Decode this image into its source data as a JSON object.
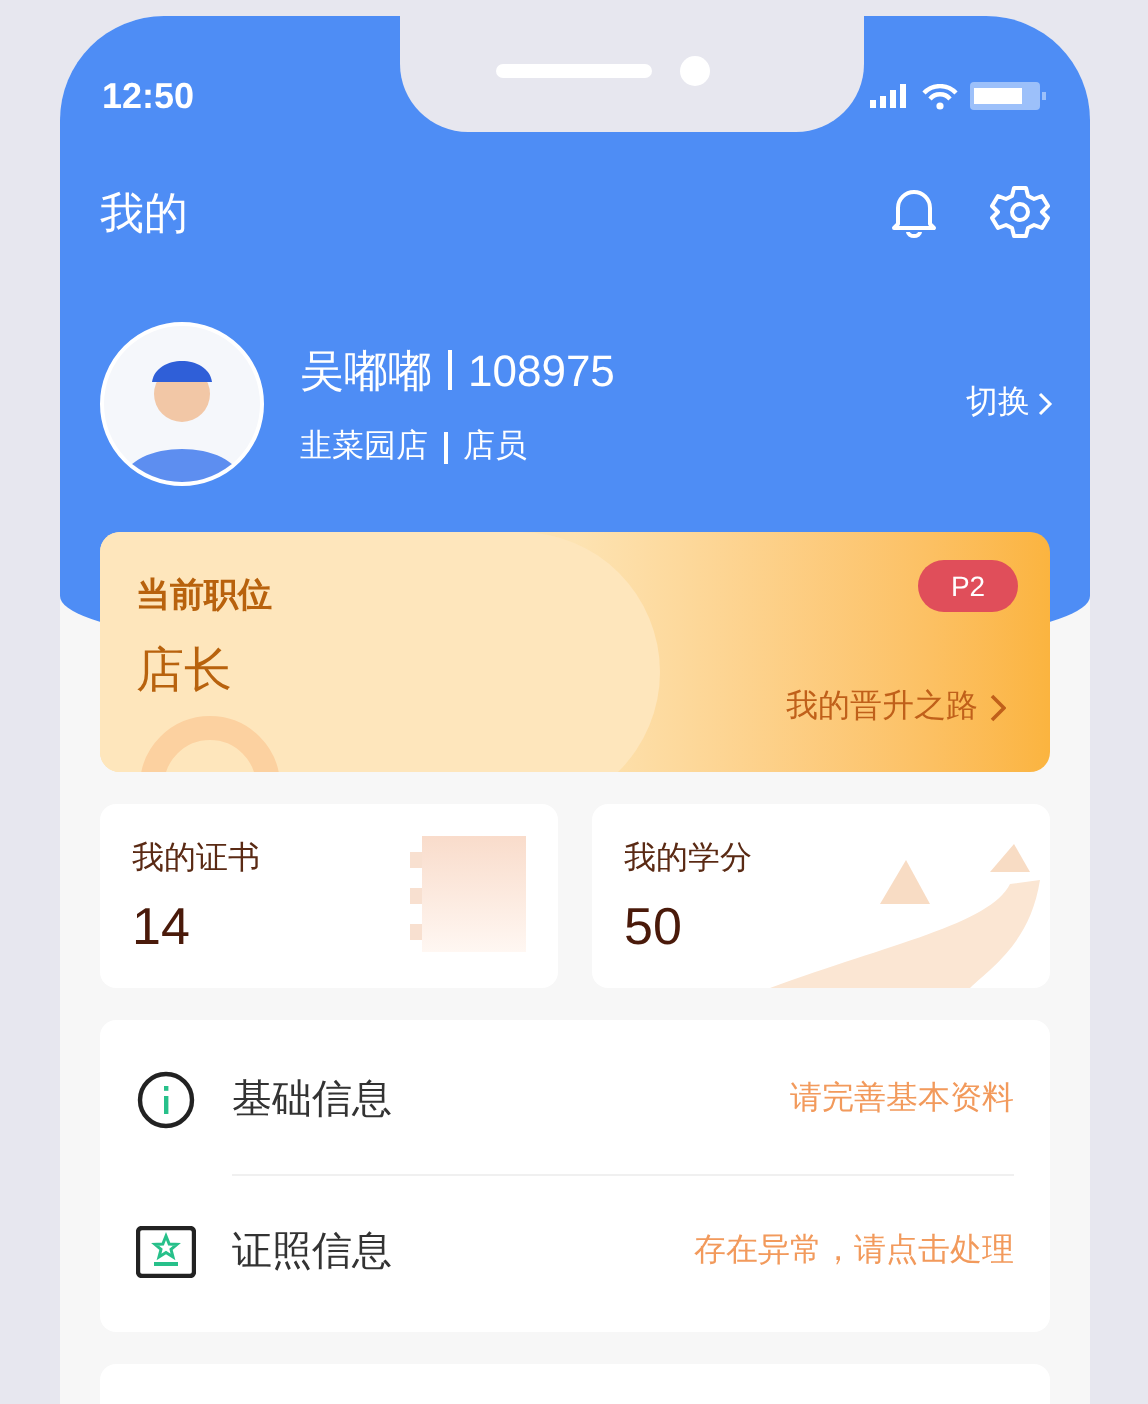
{
  "status_bar": {
    "time": "12:50"
  },
  "header": {
    "title": "我的"
  },
  "profile": {
    "name": "吴嘟嘟",
    "id": "108975",
    "store": "韭菜园店",
    "role": "店员",
    "switch_label": "切换"
  },
  "position_card": {
    "label": "当前职位",
    "value": "店长",
    "badge": "P2",
    "link": "我的晋升之路"
  },
  "stats": [
    {
      "kind": "certificate",
      "label": "我的证书",
      "value": "14"
    },
    {
      "kind": "credit",
      "label": "我的学分",
      "value": "50"
    }
  ],
  "info_items": [
    {
      "kind": "info",
      "label": "基础信息",
      "hint": "请完善基本资料"
    },
    {
      "kind": "license",
      "label": "证照信息",
      "hint": "存在异常，请点击处理"
    }
  ]
}
